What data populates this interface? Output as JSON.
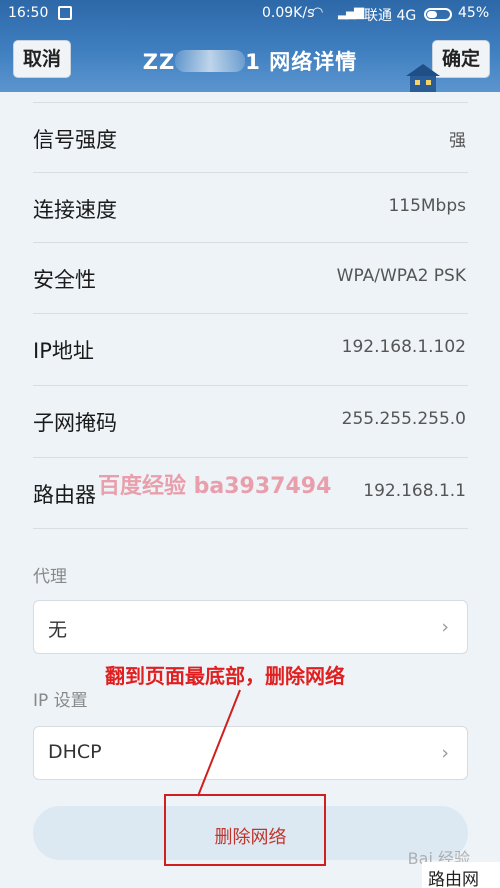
{
  "status_bar": {
    "time": "16:50",
    "network_speed": "0.09K/s",
    "carrier": "联通 4G",
    "battery": "45%",
    "battery_level": 0.45
  },
  "header": {
    "cancel_label": "取消",
    "title_start": "ZZ",
    "title_end": "1 网络详情",
    "confirm_label": "确定"
  },
  "details": [
    {
      "label": "信号强度",
      "value": "强"
    },
    {
      "label": "连接速度",
      "value": "115Mbps"
    },
    {
      "label": "安全性",
      "value": "WPA/WPA2 PSK"
    },
    {
      "label": "IP地址",
      "value": "192.168.1.102"
    },
    {
      "label": "子网掩码",
      "value": "255.255.255.0"
    },
    {
      "label": "路由器",
      "value": "192.168.1.1"
    }
  ],
  "proxy": {
    "label": "代理",
    "value": "无"
  },
  "ip_settings": {
    "label": "IP 设置",
    "value": "DHCP"
  },
  "delete_button": {
    "label": "删除网络"
  },
  "annotations": {
    "watermark": "百度经验 ba3937494",
    "instruction": "翻到页面最底部，删除网络",
    "corner_watermark": "Bai 经验",
    "corner_logo": "路由网"
  },
  "colors": {
    "header_blue": "#3f7fc0",
    "delete_red": "#c0352b",
    "annotation_red": "#e02020"
  }
}
